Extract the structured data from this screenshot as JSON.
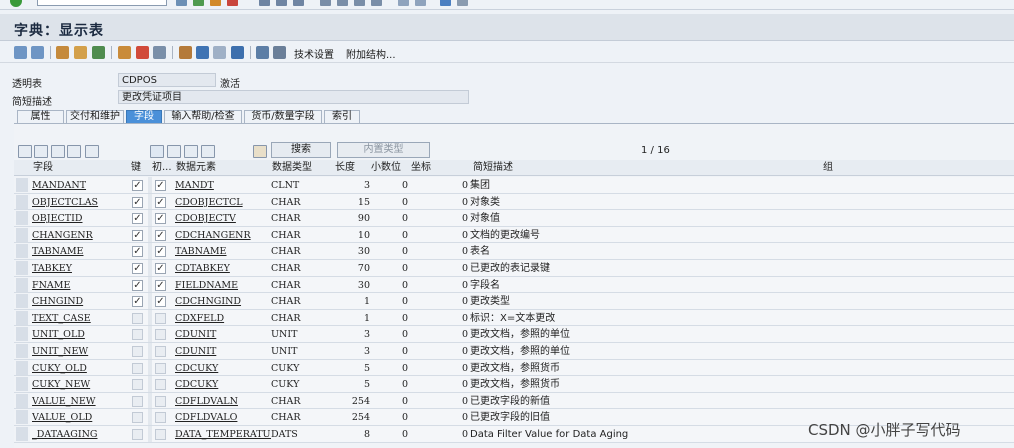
{
  "window": {
    "title": "字典：显示表"
  },
  "toolbar": {
    "tech_settings": "技术设置",
    "append_structure": "附加结构..."
  },
  "header": {
    "table_label": "透明表",
    "table_value": "CDPOS",
    "status": "激活",
    "desc_label": "简短描述",
    "desc_value": "更改凭证项目"
  },
  "tabs": [
    {
      "label": "属性"
    },
    {
      "label": "交付和维护"
    },
    {
      "label": "字段"
    },
    {
      "label": "输入帮助/检查"
    },
    {
      "label": "货币/数量字段"
    },
    {
      "label": "索引"
    }
  ],
  "grid_toolbar": {
    "search_label": "搜索",
    "builtin_type_label": "内置类型",
    "pager": "1 / 16"
  },
  "columns": {
    "field": "字段",
    "key": "键",
    "init": "初...",
    "data_element": "数据元素",
    "data_type": "数据类型",
    "length": "长度",
    "decimals": "小数位",
    "coord": "坐标",
    "short_desc": "简短描述",
    "group": "组"
  },
  "rows": [
    {
      "field": "MANDANT",
      "key": true,
      "init": true,
      "elem": "MANDT",
      "type": "CLNT",
      "len": "3",
      "dec": "0",
      "coord": "0",
      "desc": "集团"
    },
    {
      "field": "OBJECTCLAS",
      "key": true,
      "init": true,
      "elem": "CDOBJECTCL",
      "type": "CHAR",
      "len": "15",
      "dec": "0",
      "coord": "0",
      "desc": "对象类"
    },
    {
      "field": "OBJECTID",
      "key": true,
      "init": true,
      "elem": "CDOBJECTV",
      "type": "CHAR",
      "len": "90",
      "dec": "0",
      "coord": "0",
      "desc": "对象值"
    },
    {
      "field": "CHANGENR",
      "key": true,
      "init": true,
      "elem": "CDCHANGENR",
      "type": "CHAR",
      "len": "10",
      "dec": "0",
      "coord": "0",
      "desc": "文档的更改编号"
    },
    {
      "field": "TABNAME",
      "key": true,
      "init": true,
      "elem": "TABNAME",
      "type": "CHAR",
      "len": "30",
      "dec": "0",
      "coord": "0",
      "desc": "表名"
    },
    {
      "field": "TABKEY",
      "key": true,
      "init": true,
      "elem": "CDTABKEY",
      "type": "CHAR",
      "len": "70",
      "dec": "0",
      "coord": "0",
      "desc": "已更改的表记录键"
    },
    {
      "field": "FNAME",
      "key": true,
      "init": true,
      "elem": "FIELDNAME",
      "type": "CHAR",
      "len": "30",
      "dec": "0",
      "coord": "0",
      "desc": "字段名"
    },
    {
      "field": "CHNGIND",
      "key": true,
      "init": true,
      "elem": "CDCHNGIND",
      "type": "CHAR",
      "len": "1",
      "dec": "0",
      "coord": "0",
      "desc": "更改类型"
    },
    {
      "field": "TEXT_CASE",
      "key": false,
      "init": false,
      "elem": "CDXFELD",
      "type": "CHAR",
      "len": "1",
      "dec": "0",
      "coord": "0",
      "desc": "标识：X=文本更改"
    },
    {
      "field": "UNIT_OLD",
      "key": false,
      "init": false,
      "elem": "CDUNIT",
      "type": "UNIT",
      "len": "3",
      "dec": "0",
      "coord": "0",
      "desc": "更改文档，参照的单位"
    },
    {
      "field": "UNIT_NEW",
      "key": false,
      "init": false,
      "elem": "CDUNIT",
      "type": "UNIT",
      "len": "3",
      "dec": "0",
      "coord": "0",
      "desc": "更改文档，参照的单位"
    },
    {
      "field": "CUKY_OLD",
      "key": false,
      "init": false,
      "elem": "CDCUKY",
      "type": "CUKY",
      "len": "5",
      "dec": "0",
      "coord": "0",
      "desc": "更改文档，参照货币"
    },
    {
      "field": "CUKY_NEW",
      "key": false,
      "init": false,
      "elem": "CDCUKY",
      "type": "CUKY",
      "len": "5",
      "dec": "0",
      "coord": "0",
      "desc": "更改文档，参照货币"
    },
    {
      "field": "VALUE_NEW",
      "key": false,
      "init": false,
      "elem": "CDFLDVALN",
      "type": "CHAR",
      "len": "254",
      "dec": "0",
      "coord": "0",
      "desc": "已更改字段的新值"
    },
    {
      "field": "VALUE_OLD",
      "key": false,
      "init": false,
      "elem": "CDFLDVALO",
      "type": "CHAR",
      "len": "254",
      "dec": "0",
      "coord": "0",
      "desc": "已更改字段的旧值"
    },
    {
      "field": "_DATAAGING",
      "key": false,
      "init": false,
      "elem": "DATA_TEMPERATURE",
      "type": "DATS",
      "len": "8",
      "dec": "0",
      "coord": "0",
      "desc": "Data Filter Value for Data Aging"
    }
  ],
  "watermark": "CSDN @小胖子写代码",
  "colors": {
    "active_tab": "#4a90d9",
    "title_bar": "#dde3ea",
    "background": "#eef2f7"
  }
}
